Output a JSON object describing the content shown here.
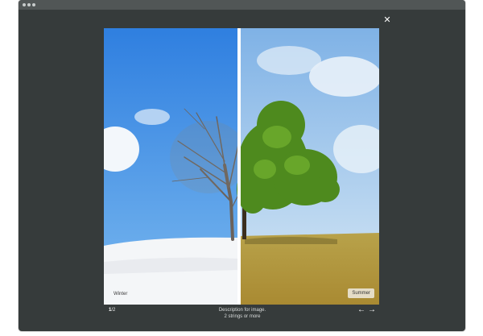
{
  "window": {
    "background": "#363b3b"
  },
  "close": {
    "glyph": "✕"
  },
  "slide": {
    "left_label": "Winter",
    "right_label": "Summer"
  },
  "counter": {
    "current": "1",
    "total": "/2"
  },
  "caption": {
    "line1": "Description for image.",
    "line2": "2 strings or more"
  },
  "nav": {
    "prev": "←",
    "next": "→"
  }
}
